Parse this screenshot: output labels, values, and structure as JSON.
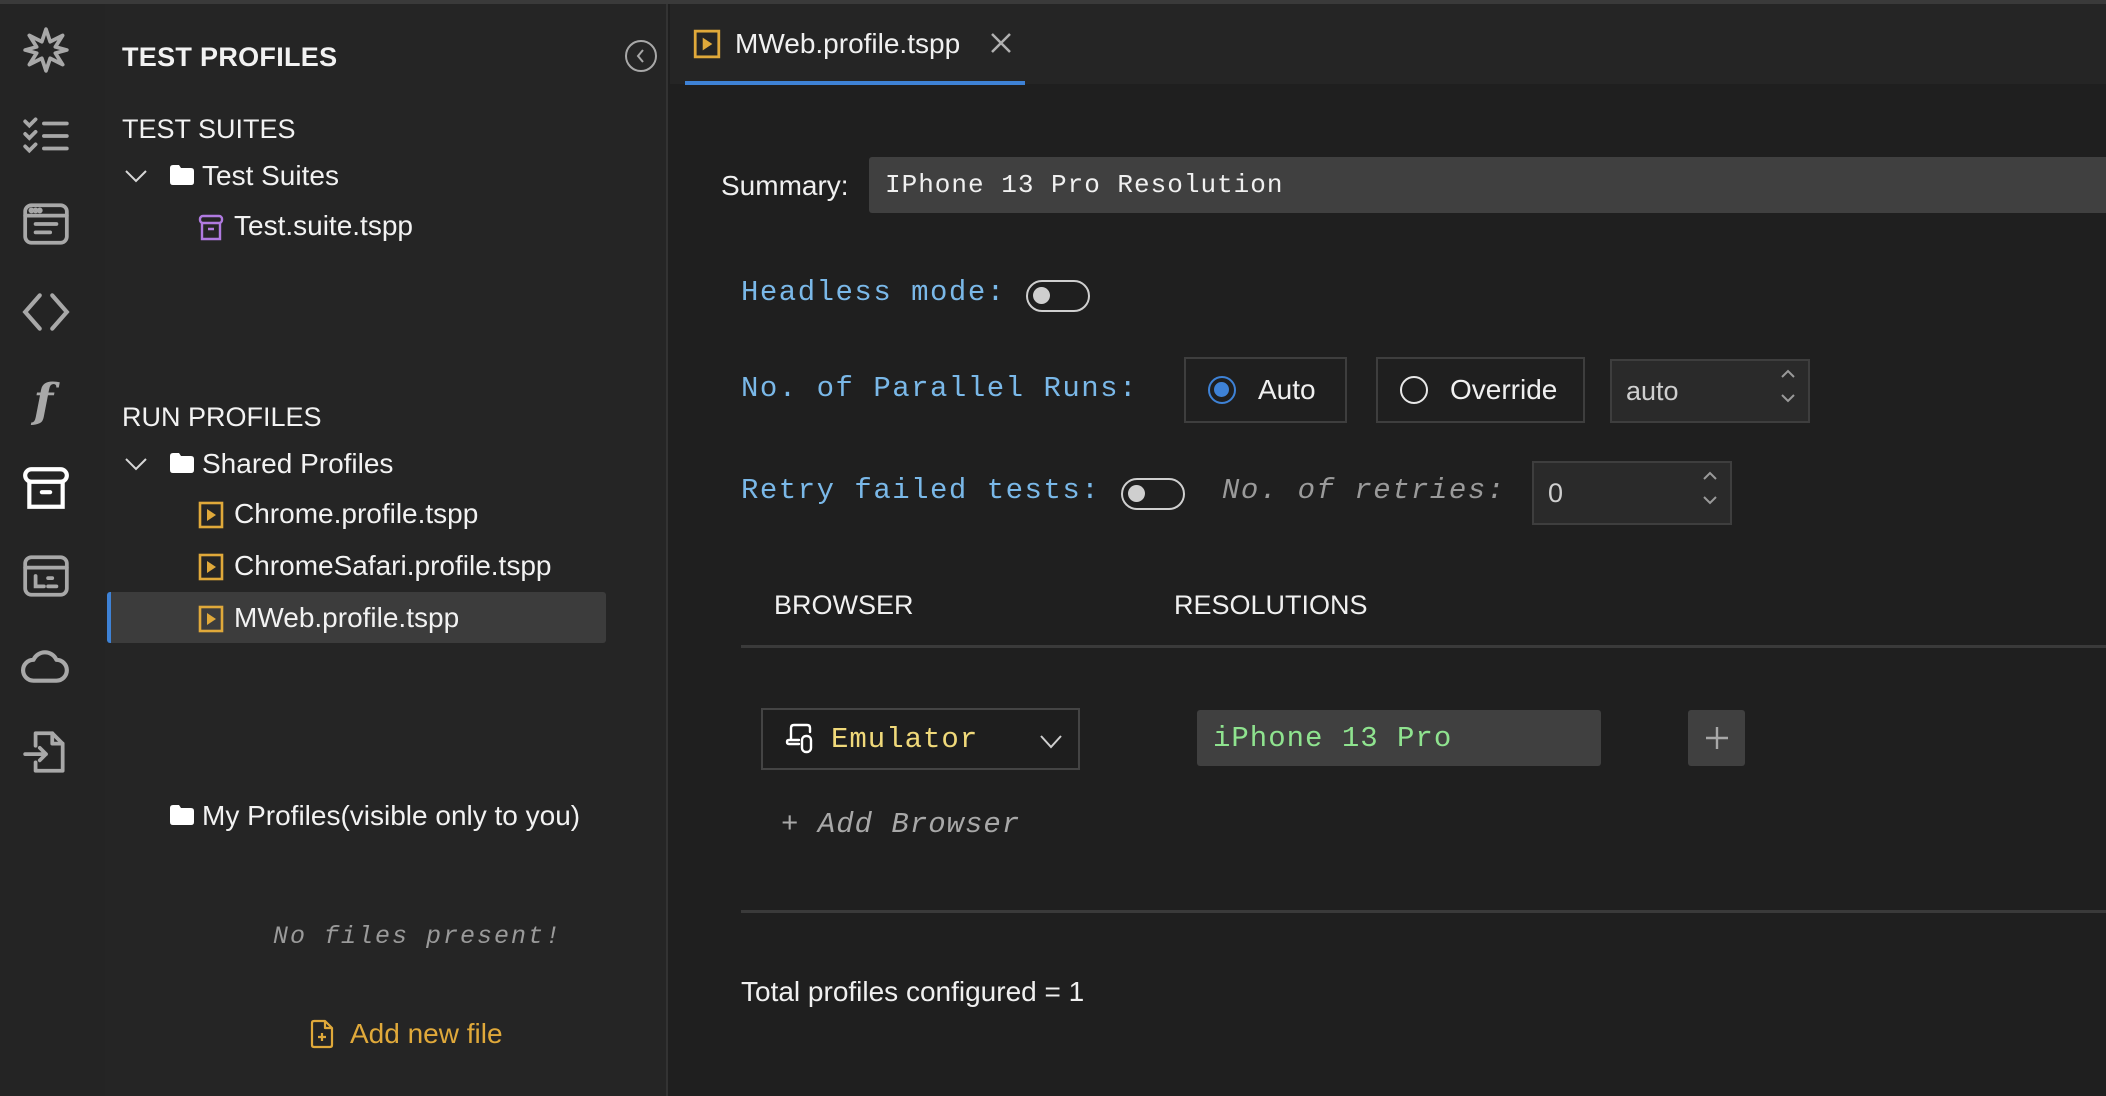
{
  "activity_bar": {
    "items": [
      {
        "name": "sparkle-icon",
        "active": false
      },
      {
        "name": "test-checklist-icon",
        "active": false
      },
      {
        "name": "browser-window-icon",
        "active": false
      },
      {
        "name": "code-brackets-icon",
        "active": false
      },
      {
        "name": "function-icon",
        "active": false
      },
      {
        "name": "archive-box-icon",
        "active": true
      },
      {
        "name": "dashboard-window-icon",
        "active": false
      },
      {
        "name": "cloud-icon",
        "active": false
      },
      {
        "name": "file-import-icon",
        "active": false
      }
    ]
  },
  "sidebar": {
    "title": "TEST PROFILES",
    "collapse_icon": "chevron-left-circle-icon",
    "test_suites": {
      "heading": "TEST SUITES",
      "folder": "Test Suites",
      "files": [
        "Test.suite.tspp"
      ]
    },
    "run_profiles": {
      "heading": "RUN PROFILES",
      "shared_folder": "Shared Profiles",
      "files": [
        "Chrome.profile.tspp",
        "ChromeSafari.profile.tspp",
        "MWeb.profile.tspp"
      ],
      "selected": "MWeb.profile.tspp",
      "my_folder": "My Profiles(visible only to you)",
      "empty_message": "No files present!",
      "add_file_label": "Add new file"
    }
  },
  "editor": {
    "tab": {
      "label": "MWeb.profile.tspp",
      "close_icon": "close-icon"
    },
    "summary": {
      "label": "Summary:",
      "value": "IPhone 13 Pro Resolution"
    },
    "headless": {
      "label": "Headless mode:",
      "enabled": false
    },
    "parallel_runs": {
      "label": "No. of Parallel Runs:",
      "options": [
        "Auto",
        "Override"
      ],
      "selected": "Auto",
      "value": "auto"
    },
    "retry": {
      "label": "Retry failed tests:",
      "enabled": false,
      "retries_label": "No. of retries:",
      "retries_value": "0"
    },
    "table": {
      "headers": [
        "BROWSER",
        "RESOLUTIONS"
      ],
      "rows": [
        {
          "browser": "Emulator",
          "resolutions": [
            "iPhone 13 Pro"
          ]
        }
      ],
      "add_browser_label": "+ Add Browser"
    },
    "total_label": "Total profiles configured = 1"
  },
  "colors": {
    "accent": "#3e82d6",
    "profile_icon": "#e0a93a",
    "suite_icon": "#b07ae0",
    "label_blue": "#7ab8e8",
    "browser_yellow": "#f0d97a",
    "resolution_green": "#8fe38f"
  }
}
